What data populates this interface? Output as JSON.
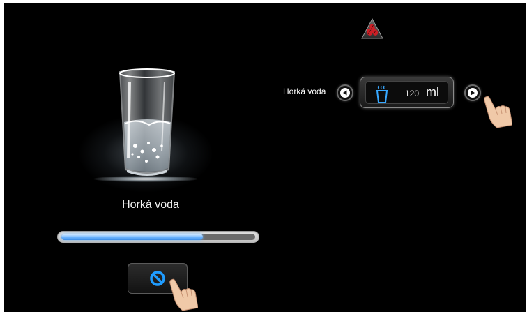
{
  "status": {
    "warning_icon": "coffee-beans-warning-icon",
    "warning_color": "#cc1f26"
  },
  "product": {
    "name": "Horká voda",
    "image": "hot-water-glass-image"
  },
  "progress": {
    "fraction": 0.73,
    "fill_color": "#6fb6ff"
  },
  "cancel": {
    "icon": "cancel-icon",
    "icon_color": "#1f9cff"
  },
  "volume": {
    "label": "Horká voda",
    "value": "120",
    "unit": "ml",
    "cup_icon": "hot-cup-icon",
    "cup_color": "#37a8ff",
    "left_icon": "arrow-left-icon",
    "right_icon": "arrow-right-icon"
  }
}
